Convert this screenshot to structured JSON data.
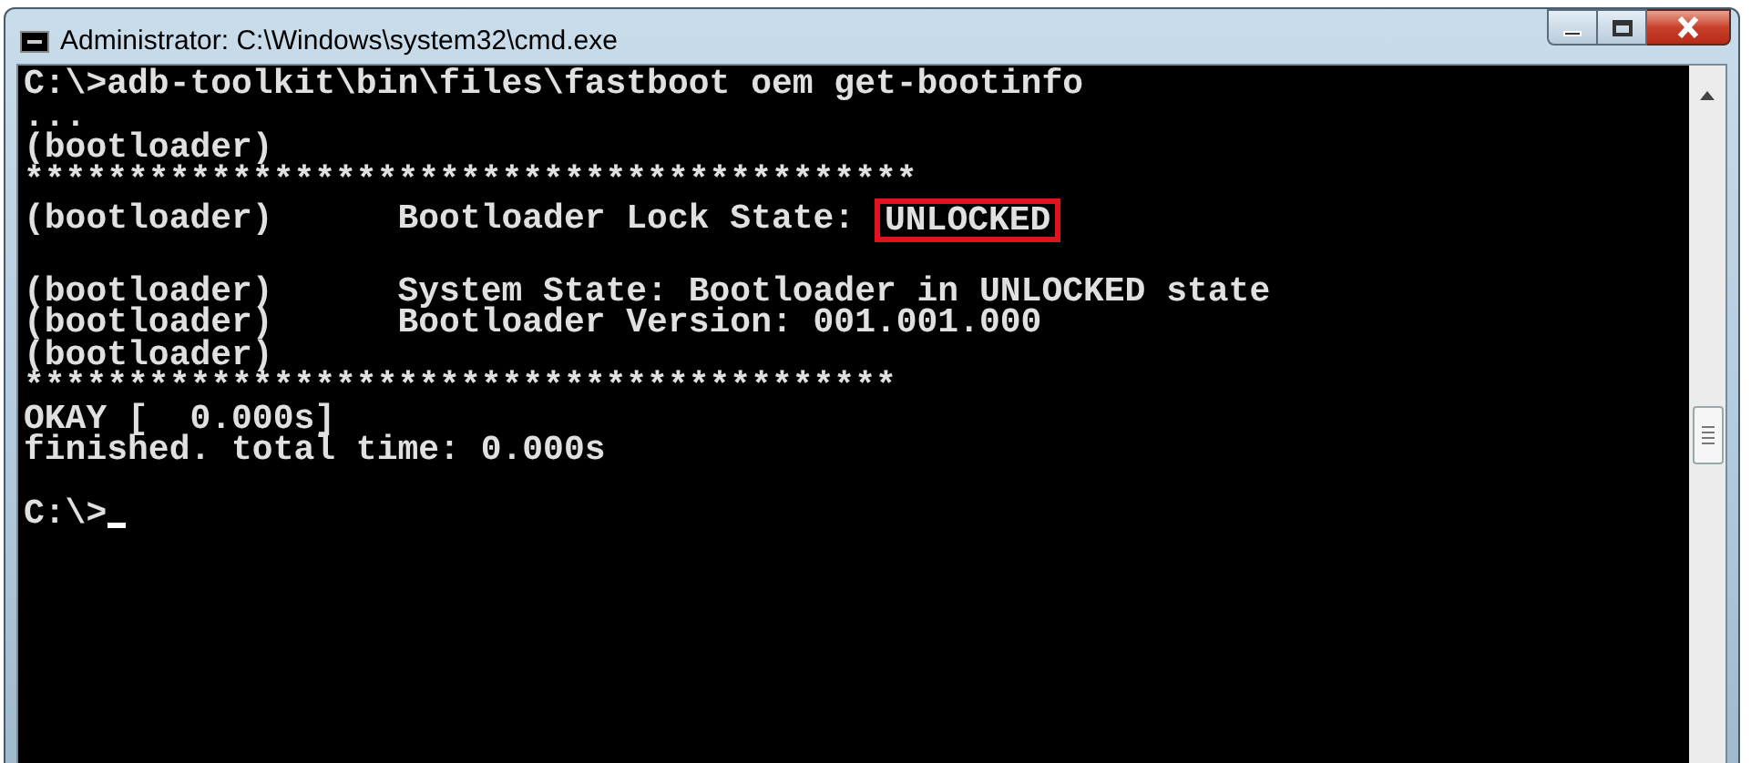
{
  "window": {
    "title": "Administrator: C:\\Windows\\system32\\cmd.exe"
  },
  "console": {
    "lines": [
      {
        "kind": "text",
        "text": "C:\\>adb-toolkit\\bin\\files\\fastboot oem get-bootinfo"
      },
      {
        "kind": "text",
        "text": "..."
      },
      {
        "kind": "text",
        "text": "(bootloader)"
      },
      {
        "kind": "text",
        "text": "*******************************************"
      },
      {
        "kind": "highlight",
        "text": "(bootloader)      Bootloader Lock State: ",
        "highlight": "UNLOCKED"
      },
      {
        "kind": "blank"
      },
      {
        "kind": "text",
        "text": "(bootloader)      System State: Bootloader in UNLOCKED state"
      },
      {
        "kind": "text",
        "text": "(bootloader)      Bootloader Version: 001.001.000"
      },
      {
        "kind": "text",
        "text": "(bootloader)"
      },
      {
        "kind": "text",
        "text": "******************************************"
      },
      {
        "kind": "text",
        "text": "OKAY [  0.000s]"
      },
      {
        "kind": "text",
        "text": "finished. total time: 0.000s"
      },
      {
        "kind": "blank"
      },
      {
        "kind": "prompt",
        "text": "C:\\>"
      }
    ]
  }
}
